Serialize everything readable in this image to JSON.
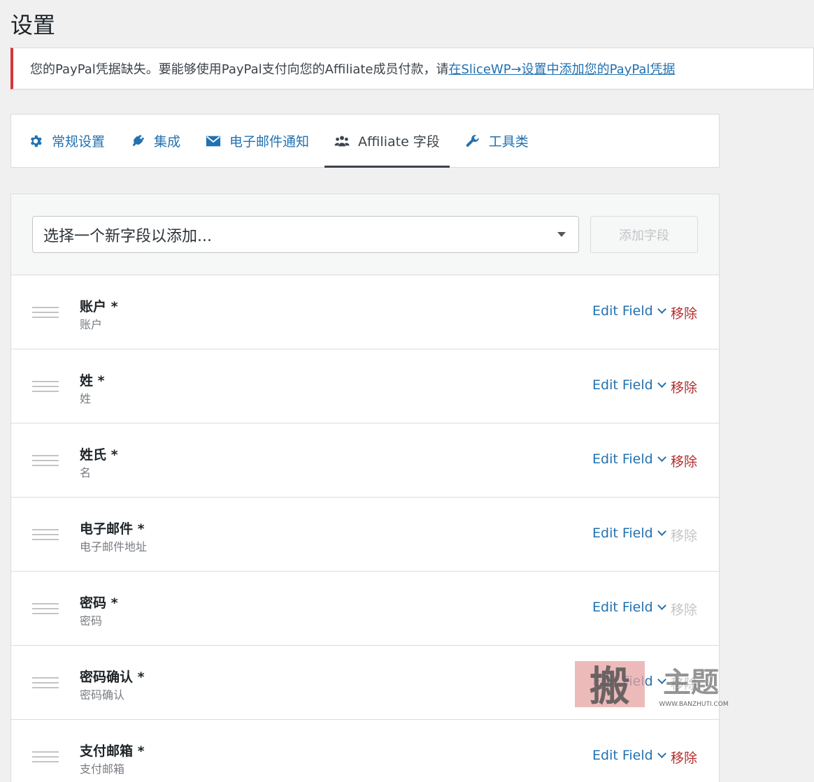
{
  "page": {
    "title": "设置"
  },
  "notice": {
    "text": "您的PayPal凭据缺失。要能够使用PayPal支付向您的Affiliate成员付款，请",
    "link_text": "在SliceWP→设置中添加您的PayPal凭据"
  },
  "tabs": [
    {
      "label": "常规设置",
      "icon": "gear-icon",
      "active": false
    },
    {
      "label": "集成",
      "icon": "plug-icon",
      "active": false
    },
    {
      "label": "电子邮件通知",
      "icon": "envelope-icon",
      "active": false
    },
    {
      "label": "Affiliate 字段",
      "icon": "users-icon",
      "active": true
    },
    {
      "label": "工具类",
      "icon": "wrench-icon",
      "active": false
    }
  ],
  "field_picker": {
    "placeholder": "选择一个新字段以添加...",
    "add_button": "添加字段"
  },
  "fields": [
    {
      "title": "账户 *",
      "subtitle": "账户",
      "edit_label": "Edit Field",
      "remove_label": "移除",
      "removable": true
    },
    {
      "title": "姓 *",
      "subtitle": "姓",
      "edit_label": "Edit Field",
      "remove_label": "移除",
      "removable": true
    },
    {
      "title": "姓氏  *",
      "subtitle": "名",
      "edit_label": "Edit Field",
      "remove_label": "移除",
      "removable": true
    },
    {
      "title": "电子邮件 *",
      "subtitle": "电子邮件地址",
      "edit_label": "Edit Field",
      "remove_label": "移除",
      "removable": false
    },
    {
      "title": "密码 *",
      "subtitle": "密码",
      "edit_label": "Edit Field",
      "remove_label": "移除",
      "removable": false
    },
    {
      "title": "密码确认 *",
      "subtitle": "密码确认",
      "edit_label": "Edit Field",
      "remove_label": "移除",
      "removable": false
    },
    {
      "title": "支付邮箱 *",
      "subtitle": "支付邮箱",
      "edit_label": "Edit Field",
      "remove_label": "移除",
      "removable": true
    }
  ],
  "watermark": {
    "text": "搬主题",
    "url_text": "WWW.BANZHUTI.COM"
  },
  "colors": {
    "link": "#2271b1",
    "remove": "#b32d2e",
    "notice_border": "#d63638"
  }
}
